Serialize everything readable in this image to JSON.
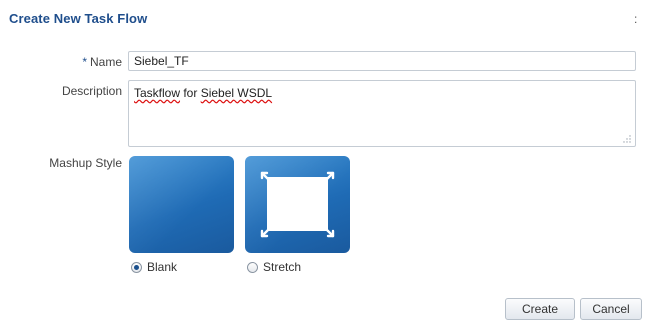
{
  "dialog": {
    "title": "Create New Task Flow",
    "close_glyph": ":"
  },
  "form": {
    "name": {
      "required_marker": "*",
      "label": "Name",
      "value": "Siebel_TF"
    },
    "description": {
      "label": "Description",
      "value_plain": "Taskflow for ",
      "value_underlined": "Siebel WSDL",
      "first_word_underlined": "Taskflow"
    },
    "mashup_style": {
      "label": "Mashup Style",
      "options": [
        {
          "label": "Blank",
          "selected": true,
          "icon": "blank-tile-icon"
        },
        {
          "label": "Stretch",
          "selected": false,
          "icon": "stretch-tile-icon"
        }
      ]
    }
  },
  "buttons": {
    "create": "Create",
    "cancel": "Cancel"
  },
  "colors": {
    "title": "#1f4e8c",
    "tile_blue": "#1f6bb5"
  }
}
